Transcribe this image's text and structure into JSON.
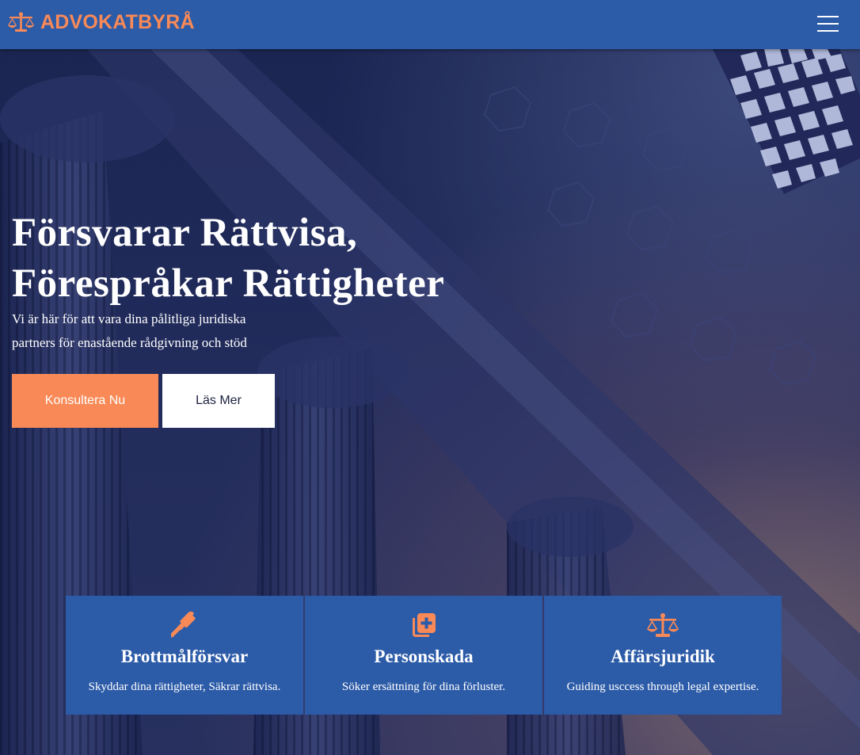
{
  "colors": {
    "navbar": "#2c5ba8",
    "accent": "#f98a57",
    "hero_overlay": "#1d2753",
    "card": "#2c5ba8",
    "text_light": "#ffffff"
  },
  "nav": {
    "brand_icon": "scale-balance-icon",
    "brand_name": "ADVOKATBYRÅ",
    "menu_icon": "hamburger-menu-icon"
  },
  "hero": {
    "title_line1": "Försvarar Rättvisa,",
    "title_line2": "Förespråkar Rättigheter",
    "subtitle": "Vi är här för att vara dina pålitliga juridiska partners för enastående rådgivning och stöd",
    "primary_button": "Konsultera Nu",
    "secondary_button": "Läs Mer"
  },
  "services": [
    {
      "icon": "gavel-icon",
      "title": "Brottmålförsvar",
      "description": "Skyddar dina rättigheter, Säkrar rättvisa."
    },
    {
      "icon": "medical-copy-icon",
      "title": "Personskada",
      "description": "Söker ersättning för dina förluster."
    },
    {
      "icon": "scale-balance-icon",
      "title": "Affärsjuridik",
      "description": "Guiding usccess through legal expertise."
    }
  ]
}
